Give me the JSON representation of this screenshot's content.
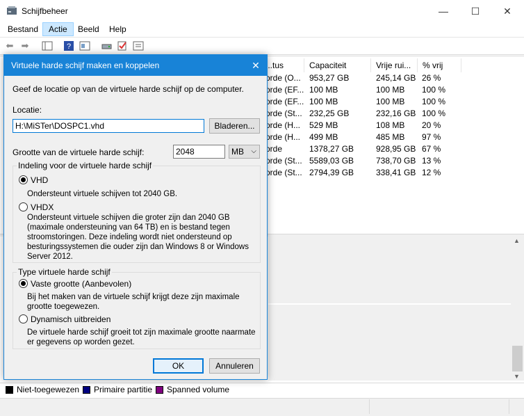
{
  "window": {
    "title": "Schijfbeheer",
    "minimize": "—",
    "maximize": "☐",
    "close": "✕"
  },
  "menu": [
    "Bestand",
    "Actie",
    "Beeld",
    "Help"
  ],
  "volume_table": {
    "columns": [
      "...tus",
      "Capaciteit",
      "Vrije rui...",
      "% vrij"
    ],
    "rows": [
      [
        "orde (O...",
        "953,27 GB",
        "245,14 GB",
        "26 %"
      ],
      [
        "orde (EF...",
        "100 MB",
        "100 MB",
        "100 %"
      ],
      [
        "orde (EF...",
        "100 MB",
        "100 MB",
        "100 %"
      ],
      [
        "orde (St...",
        "232,25 GB",
        "232,16 GB",
        "100 %"
      ],
      [
        "orde (H...",
        "529 MB",
        "108 MB",
        "20 %"
      ],
      [
        "orde (H...",
        "499 MB",
        "485 MB",
        "97 %"
      ],
      [
        "orde",
        "1378,27 GB",
        "928,95 GB",
        "67 %"
      ],
      [
        "orde (St...",
        "5589,03 GB",
        "738,70 GB",
        "13 %"
      ],
      [
        "orde (St...",
        "2794,39 GB",
        "338,41 GB",
        "12 %"
      ]
    ]
  },
  "legend": [
    {
      "label": "Niet-toegewezen",
      "color": "#000000"
    },
    {
      "label": "Primaire partitie",
      "color": "#000080"
    },
    {
      "label": "Spanned volume",
      "color": "#800080"
    }
  ],
  "dialog": {
    "title": "Virtuele harde schijf maken en koppelen",
    "intro": "Geef de locatie op van de virtuele harde schijf op de computer.",
    "location_label": "Locatie:",
    "location_value": "H:\\MiSTer\\DOSPC1.vhd",
    "browse_button": "Bladeren...",
    "size_label": "Grootte van de virtuele harde schijf:",
    "size_value": "2048",
    "size_unit": "MB",
    "format_group": {
      "label": "Indeling voor de virtuele harde schijf",
      "options": [
        {
          "label": "VHD",
          "checked": true,
          "desc": "Ondersteunt virtuele schijven tot 2040 GB."
        },
        {
          "label": "VHDX",
          "checked": false,
          "desc": "Ondersteunt virtuele schijven die groter zijn dan 2040 GB (maximale ondersteuning van 64 TB) en is bestand tegen stroomstoringen. Deze indeling wordt niet ondersteund op besturingssystemen die ouder zijn dan Windows 8 or Windows Server 2012."
        }
      ]
    },
    "type_group": {
      "label": "Type virtuele harde schijf",
      "options": [
        {
          "label": "Vaste grootte (Aanbevolen)",
          "checked": true,
          "desc": "Bij het maken van de virtuele schijf krijgt deze zijn maximale grootte toegewezen."
        },
        {
          "label": "Dynamisch uitbreiden",
          "checked": false,
          "desc": "De virtuele harde schijf groeit tot zijn maximale grootte naarmate er gegevens op worden gezet."
        }
      ]
    },
    "ok_button": "OK",
    "cancel_button": "Annuleren",
    "close": "✕"
  }
}
